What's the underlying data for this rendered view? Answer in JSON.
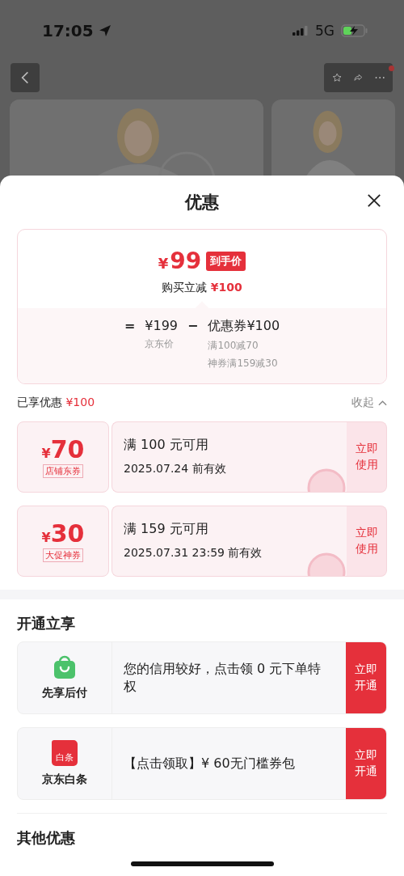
{
  "status_bar": {
    "time": "17:05",
    "network": "5G"
  },
  "sheet": {
    "title": "优惠"
  },
  "price_card": {
    "currency": "¥",
    "price": "99",
    "badge": "到手价",
    "reduction_label": "购买立减",
    "reduction": "¥100",
    "formula": {
      "equals": "=",
      "base": "¥199",
      "minus": "−",
      "coupon": "优惠券¥100",
      "base_label": "京东价",
      "details": [
        "满100减70",
        "神券满159减30"
      ]
    }
  },
  "enjoyed": {
    "label": "已享优惠",
    "amount": "¥100",
    "toggle": "收起",
    "expanded": true
  },
  "coupons": [
    {
      "currency": "¥",
      "amount": "70",
      "tag": "店铺东券",
      "condition": "满 100 元可用",
      "validity": "2025.07.24 前有效",
      "action": "立即使用"
    },
    {
      "currency": "¥",
      "amount": "30",
      "tag": "大促神券",
      "condition": "满 159 元可用",
      "validity": "2025.07.31 23:59 前有效",
      "action": "立即使用"
    }
  ],
  "activate": {
    "title": "开通立享",
    "items": [
      {
        "kind": "bag",
        "name": "先享后付",
        "text": "您的信用较好，点击领 0 元下单特权",
        "action": "立即开通"
      },
      {
        "kind": "baitiao",
        "icon_text": "白条",
        "name": "京东白条",
        "text": "【点击领取】¥ 60无门槛券包",
        "action": "立即开通"
      }
    ]
  },
  "other": {
    "title": "其他优惠"
  }
}
